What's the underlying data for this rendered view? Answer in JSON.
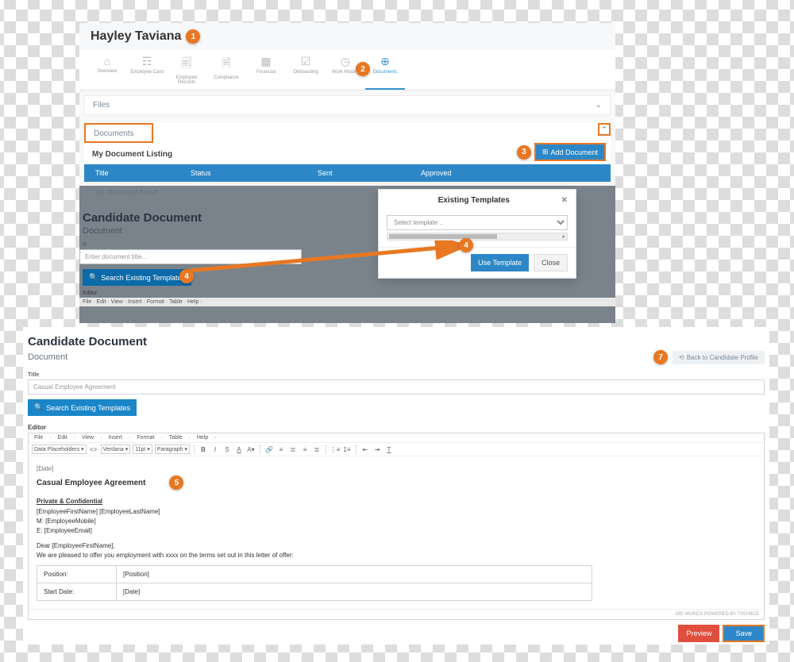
{
  "panel1": {
    "employee_name": "Hayley Taviana",
    "tabs": [
      {
        "label": "Overview",
        "icon": "⌂"
      },
      {
        "label": "Employee Card",
        "icon": "☶"
      },
      {
        "label": "Employee Records",
        "icon": "🗐"
      },
      {
        "label": "Compliance",
        "icon": "🗎"
      },
      {
        "label": "Financial",
        "icon": "▦"
      },
      {
        "label": "Onboarding",
        "icon": "☑"
      },
      {
        "label": "Work History",
        "icon": "◷"
      },
      {
        "label": "Documents",
        "icon": "⊕"
      }
    ],
    "files_label": "Files",
    "docs_tab": "Documents",
    "listing_title": "My Document Listing",
    "add_doc": "Add Document",
    "columns": {
      "title": "Title",
      "status": "Status",
      "sent": "Sent",
      "approved": "Approved"
    },
    "empty": "No document found"
  },
  "overlay": {
    "title": "Candidate Document",
    "sub": "Document",
    "input_hint": "Enter document title...",
    "search_btn": "Search Existing Templates",
    "editor_label": "Editor",
    "menu": "File ·   Edit ·   View ·   Insert ·   Format ·   Table ·   Help ·"
  },
  "modal": {
    "title": "Existing Templates",
    "placeholder": "Select template ..",
    "use": "Use Template",
    "close": "Close"
  },
  "panel2": {
    "title": "Candidate Document",
    "sub": "Document",
    "back": "Back to Candidate Profile",
    "title_label": "Title",
    "title_value": "Casual Employee Agreement",
    "search_btn": "Search Existing Templates",
    "editor_label": "Editor",
    "menu_items": [
      "File",
      "Edit",
      "View",
      "Insert",
      "Format",
      "Table",
      "Help"
    ],
    "toolbar": {
      "data_ph": "Data Placeholders",
      "font": "Verdana",
      "size": "11pt",
      "para": "Paragraph"
    },
    "doc": {
      "date_ph": "[Date]",
      "heading": "Casual Employee Agreement",
      "conf": "Private & Confidential",
      "name_line": "[EmployeeFirstName] [EmployeeLastName]",
      "mobile_line": "M: [EmployeeMobile]",
      "email_line": "E: [EmployeeEmail]",
      "dear": "Dear [EmployeeFirstName],",
      "offer": "We are pleased to offer you employment with xxxx on the terms set out in this letter of offer:",
      "rows": [
        {
          "label": "Position:",
          "value": "[Position]"
        },
        {
          "label": "Start Date:",
          "value": "[Date]"
        }
      ]
    },
    "powered": "995 WORDS POWERED BY TINYMCE",
    "preview": "Preview",
    "save": "Save"
  },
  "callouts": {
    "c1": "1",
    "c2": "2",
    "c3": "3",
    "c4": "4",
    "c5": "5",
    "c7": "7"
  }
}
